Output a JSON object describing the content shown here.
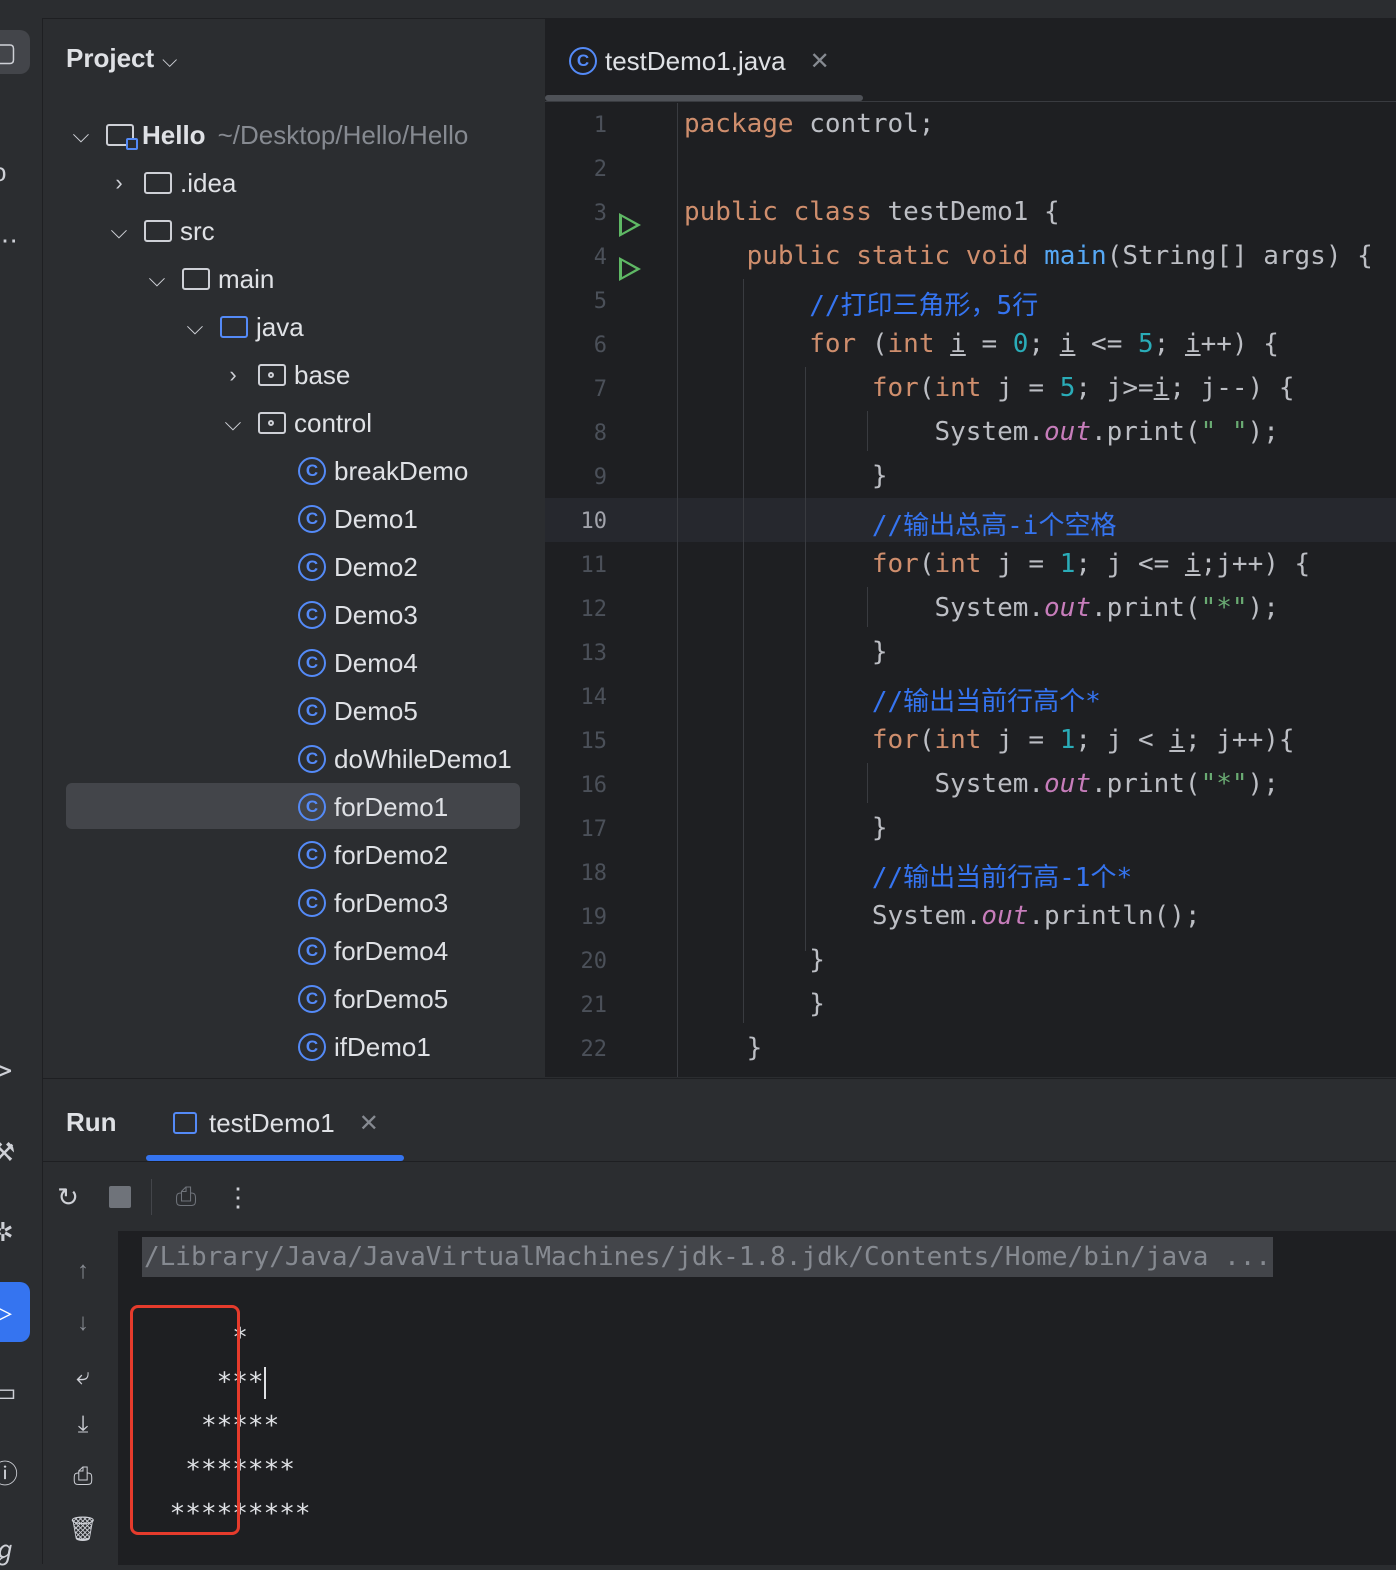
{
  "project_panel": {
    "title": "Project",
    "tree": {
      "root_name": "Hello",
      "root_path": "~/Desktop/Hello/Hello",
      "idea": ".idea",
      "src": "src",
      "main": "main",
      "java": "java",
      "base": "base",
      "control": "control",
      "classes": [
        "breakDemo",
        "Demo1",
        "Demo2",
        "Demo3",
        "Demo4",
        "Demo5",
        "doWhileDemo1",
        "forDemo1",
        "forDemo2",
        "forDemo3",
        "forDemo4",
        "forDemo5",
        "ifDemo1"
      ],
      "selected": "forDemo1"
    }
  },
  "editor": {
    "tab_label": "testDemo1.java",
    "current_line": 10,
    "line_numbers": [
      "1",
      "2",
      "3",
      "4",
      "5",
      "6",
      "7",
      "8",
      "9",
      "10",
      "11",
      "12",
      "13",
      "14",
      "15",
      "16",
      "17",
      "18",
      "19",
      "20",
      "21",
      "22"
    ],
    "code": {
      "l1_kw": "package",
      "l1_rest": " control;",
      "l3_kw1": "public",
      "l3_kw2": "class",
      "l3_rest": " testDemo1 {",
      "l4_kw1": "public",
      "l4_kw2": "static",
      "l4_kw3": "void",
      "l4_fn": "main",
      "l4_rest": "(String[] args) {",
      "l5_cmt": "//打印三角形，5行",
      "l6_kw": "for",
      "l6_p1": " (",
      "l6_kw2": "int",
      "l6_var1": "i",
      "l6_p2": " = ",
      "l6_n1": "0",
      "l6_p3": "; ",
      "l6_var2": "i",
      "l6_p4": " <= ",
      "l6_n2": "5",
      "l6_p5": "; ",
      "l6_var3": "i",
      "l6_p6": "++) {",
      "l7_kw": "for",
      "l7_p1": "(",
      "l7_kw2": "int",
      "l7_p2": " j = ",
      "l7_n1": "5",
      "l7_p3": "; j>=",
      "l7_var": "i",
      "l7_p4": "; j--) {",
      "l8_p1": "System.",
      "l8_fld": "out",
      "l8_p2": ".print(",
      "l8_str": "\" \"",
      "l8_p3": ");",
      "l9": "}",
      "l10_cmt": "//输出总高-i个空格",
      "l11_kw": "for",
      "l11_p1": "(",
      "l11_kw2": "int",
      "l11_p2": " j = ",
      "l11_n1": "1",
      "l11_p3": "; j <= ",
      "l11_var": "i",
      "l11_p4": ";j++) {",
      "l12_p1": "System.",
      "l12_fld": "out",
      "l12_p2": ".print(",
      "l12_str": "\"*\"",
      "l12_p3": ");",
      "l13": "}",
      "l14_cmt": "//输出当前行高个*",
      "l15_kw": "for",
      "l15_p1": "(",
      "l15_kw2": "int",
      "l15_p2": " j = ",
      "l15_n1": "1",
      "l15_p3": "; j < ",
      "l15_var": "i",
      "l15_p4": "; j++){",
      "l16_p1": "System.",
      "l16_fld": "out",
      "l16_p2": ".print(",
      "l16_str": "\"*\"",
      "l16_p3": ");",
      "l17": "}",
      "l18_cmt": "//输出当前行高-1个*",
      "l19_p1": "System.",
      "l19_fld": "out",
      "l19_p2": ".println();",
      "l20": "}",
      "l21": "}",
      "l22": "}"
    }
  },
  "run_panel": {
    "title": "Run",
    "tab_label": "testDemo1",
    "command": "/Library/Java/JavaVirtualMachines/jdk-1.8.jdk/Contents/Home/bin/java ...",
    "output": [
      "     *",
      "    ***",
      "   *****",
      "  *******",
      " *********"
    ]
  },
  "icons": {
    "run_gutter": "run-triangle-icon",
    "class": "class-c-icon",
    "rerun": "rerun-icon",
    "stop": "stop-icon",
    "screenshot": "camera-icon",
    "more": "more-vertical-icon"
  },
  "colors": {
    "accent": "#3574f0",
    "highlight_box": "#e53b2c",
    "keyword": "#cf8e6d",
    "string": "#6aab73",
    "number": "#2aacb8",
    "comment": "#3574f0"
  }
}
